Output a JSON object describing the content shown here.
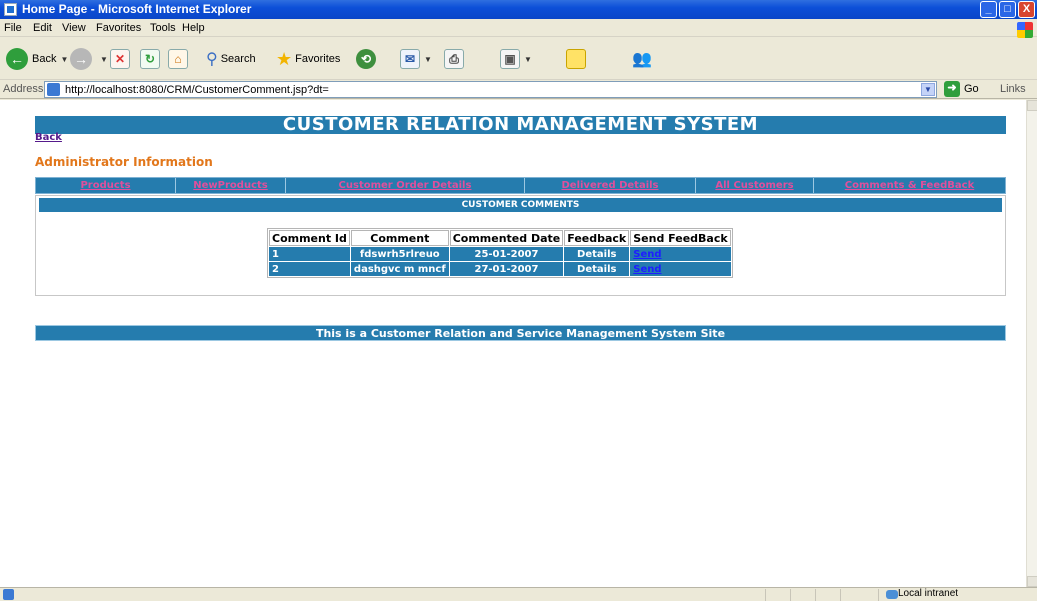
{
  "window": {
    "title": "Home Page - Microsoft Internet Explorer",
    "buttons": {
      "minimize": "_",
      "maximize": "□",
      "close": "X"
    }
  },
  "menu": [
    "File",
    "Edit",
    "View",
    "Favorites",
    "Tools",
    "Help"
  ],
  "toolbar": {
    "back": "Back",
    "search": "Search",
    "favorites": "Favorites"
  },
  "address": {
    "label": "Address",
    "url": "http://localhost:8080/CRM/CustomerComment.jsp?dt=",
    "go": "Go",
    "links": "Links"
  },
  "page": {
    "site_title": "CUSTOMER RELATION MANAGEMENT SYSTEM",
    "back_link": "Back",
    "section_title": "Administrator Information",
    "nav": [
      {
        "label": "Products"
      },
      {
        "label": "NewProducts"
      },
      {
        "label": "Customer Order Details"
      },
      {
        "label": "Delivered Details"
      },
      {
        "label": "All Customers"
      },
      {
        "label": "Comments & FeedBack"
      }
    ],
    "comments_header": "CUSTOMER COMMENTS",
    "table": {
      "columns": [
        "Comment Id",
        "Comment",
        "Commented Date",
        "Feedback",
        "Send FeedBack"
      ],
      "rows": [
        {
          "id": "1",
          "comment": "fdswrh5rlreuo",
          "date": "25-01-2007",
          "feedback": "Details",
          "send": "Send"
        },
        {
          "id": "2",
          "comment": "dashgvc m mncf",
          "date": "27-01-2007",
          "feedback": "Details",
          "send": "Send"
        }
      ]
    },
    "footer": "This is a Customer Relation and Service Management System Site"
  },
  "status": {
    "zone": "Local intranet"
  },
  "colors": {
    "bar_blue": "#257cae",
    "nav_link": "#e04f9c",
    "admin_orange": "#e2771b",
    "xp_title_blue": "#0c4fd8"
  }
}
